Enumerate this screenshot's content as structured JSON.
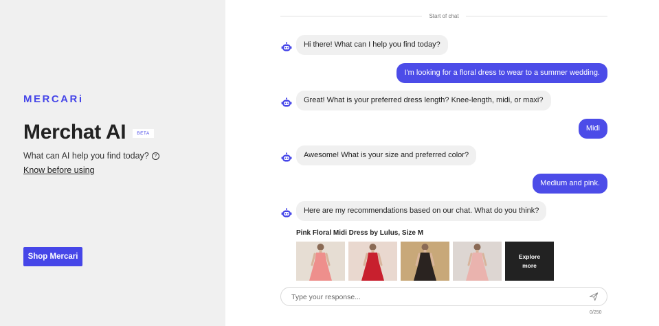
{
  "sidebar": {
    "logo": "MERCARi",
    "title": "Merchat AI",
    "badge": "BETA",
    "subtitle": "What can AI help you find today?",
    "help_icon": "help-circle-icon",
    "link": "Know before using",
    "button": "Shop Mercari"
  },
  "chat": {
    "start_label": "Start of chat",
    "messages": [
      {
        "role": "bot",
        "text": "Hi there! What can I help you find today?"
      },
      {
        "role": "user",
        "text": "I'm looking for a floral dress to wear to a summer wedding."
      },
      {
        "role": "bot",
        "text": "Great! What is your preferred dress length? Knee-length, midi, or maxi?"
      },
      {
        "role": "user",
        "text": "Midi"
      },
      {
        "role": "bot",
        "text": "Awesome! What is your size and preferred color?"
      },
      {
        "role": "user",
        "text": "Medium and pink."
      },
      {
        "role": "bot",
        "text": "Here are my recommendations based on our chat. What do you think?"
      }
    ],
    "recommendation": {
      "title": "Pink Floral Midi Dress by Lulus, Size M",
      "explore_line1": "Explore",
      "explore_line2": "more",
      "products": [
        {
          "name": "pink-floral-dress-1",
          "bg": "#e6ddd3",
          "dress": "#ee8f8c"
        },
        {
          "name": "red-floral-dress",
          "bg": "#e9d8cf",
          "dress": "#c8202e"
        },
        {
          "name": "black-floral-dress",
          "bg": "#c8a879",
          "dress": "#2a2320"
        },
        {
          "name": "pink-floral-dress-2",
          "bg": "#ddd6d2",
          "dress": "#eab3ae"
        }
      ]
    }
  },
  "composer": {
    "placeholder": "Type your response...",
    "counter": "0/250",
    "send_icon": "send-icon"
  },
  "colors": {
    "accent": "#4646e8",
    "user_bubble": "#4c4ce8",
    "bot_bubble": "#f0f0f0",
    "sidebar_bg": "#f0f0f0"
  }
}
